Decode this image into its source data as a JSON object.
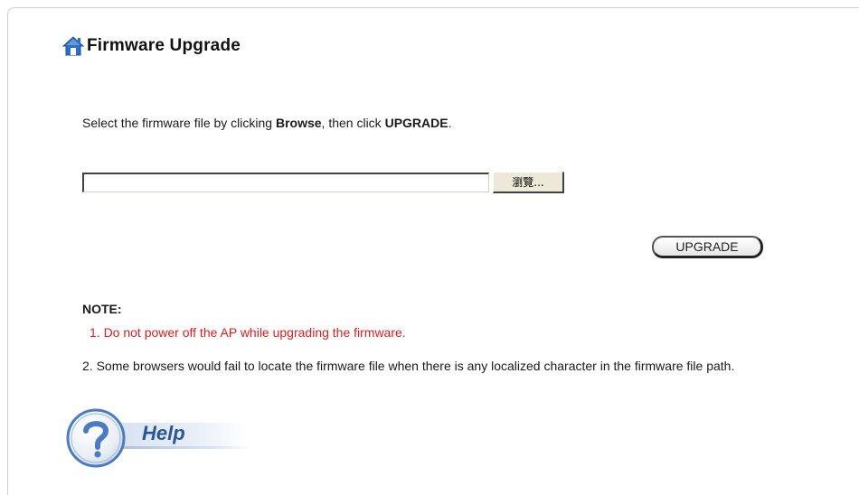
{
  "page": {
    "title": "Firmware Upgrade",
    "instruction": {
      "part1": "Select the firmware file by clicking ",
      "browse_word": "Browse",
      "part2": ", then click ",
      "upgrade_word": "UPGRADE",
      "part3": "."
    }
  },
  "file_picker": {
    "value": "",
    "browse_label": "瀏覽..."
  },
  "upgrade_button": {
    "label": "UPGRADE"
  },
  "note": {
    "title": "NOTE:",
    "items": [
      "1. Do not power off the AP while upgrading the firmware.",
      "2. Some browsers would fail to locate the firmware file when there is any localized character in the firmware file path."
    ]
  },
  "help": {
    "label": "Help"
  },
  "colors": {
    "warning_text": "#e21c1c",
    "help_text": "#2b5597",
    "icon_blue": "#2f6fc4"
  },
  "icons": {
    "title_icon": "home-icon",
    "help_icon": "question-mark-icon"
  }
}
